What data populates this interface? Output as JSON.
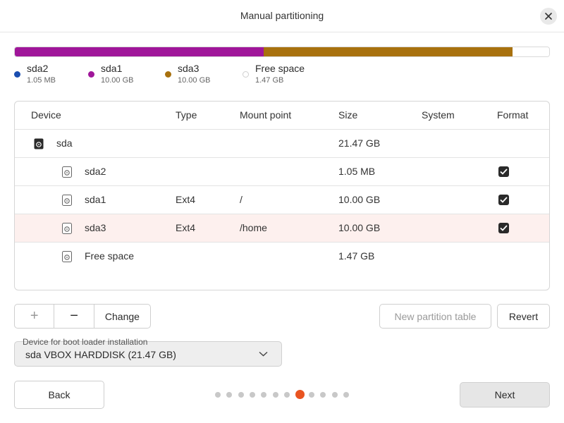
{
  "window": {
    "title": "Manual partitioning"
  },
  "usage_bar": {
    "segments": [
      {
        "name": "sda2",
        "fraction": 5e-05,
        "color": "#1a4eb0"
      },
      {
        "name": "sda1",
        "fraction": 0.466,
        "color": "#a0169a"
      },
      {
        "name": "sda3",
        "fraction": 0.466,
        "color": "#a8710e"
      },
      {
        "name": "Free space",
        "fraction": 0.068,
        "color": "#ffffff"
      }
    ]
  },
  "legend": [
    {
      "name": "sda2",
      "size": "1.05 MB",
      "color": "#1a4eb0"
    },
    {
      "name": "sda1",
      "size": "10.00 GB",
      "color": "#a0169a"
    },
    {
      "name": "sda3",
      "size": "10.00 GB",
      "color": "#a8710e"
    },
    {
      "name": "Free space",
      "size": "1.47 GB",
      "color": "#ffffff"
    }
  ],
  "table": {
    "columns": [
      "Device",
      "Type",
      "Mount point",
      "Size",
      "System",
      "Format"
    ],
    "rows": [
      {
        "device": "sda",
        "type": "",
        "mount": "",
        "size": "21.47 GB",
        "system": "",
        "format": false,
        "is_disk": true
      },
      {
        "device": "sda2",
        "type": "",
        "mount": "",
        "size": "1.05 MB",
        "system": "",
        "format": true
      },
      {
        "device": "sda1",
        "type": "Ext4",
        "mount": "/",
        "size": "10.00 GB",
        "system": "",
        "format": true
      },
      {
        "device": "sda3",
        "type": "Ext4",
        "mount": "/home",
        "size": "10.00 GB",
        "system": "",
        "format": true,
        "selected": true
      },
      {
        "device": "Free space",
        "type": "",
        "mount": "",
        "size": "1.47 GB",
        "system": "",
        "format": false
      }
    ]
  },
  "toolbar": {
    "add_label": "+",
    "remove_label": "−",
    "change_label": "Change",
    "new_table_label": "New partition table",
    "revert_label": "Revert"
  },
  "bootloader": {
    "label": "Device for boot loader installation",
    "value": "sda VBOX HARDDISK (21.47 GB)"
  },
  "nav": {
    "back_label": "Back",
    "next_label": "Next",
    "step_count": 12,
    "current_step": 8
  },
  "colors": {
    "accent": "#e95420"
  }
}
